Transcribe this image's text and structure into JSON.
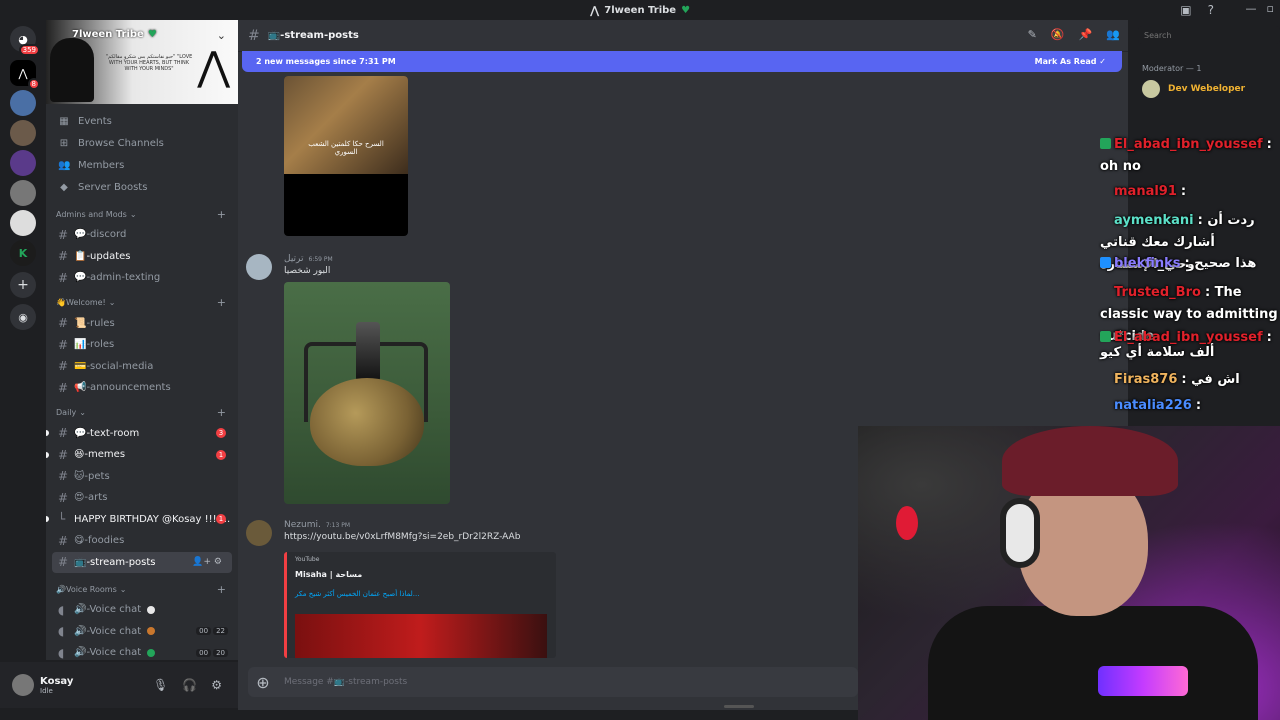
{
  "window": {
    "title": "7lween Tribe",
    "heart": "♥"
  },
  "servers": {
    "dm_badge": "359",
    "second_badge": "8"
  },
  "server": {
    "name": "7lween Tribe",
    "heart": "♥",
    "banner_quote": "\"حبو نفاستكم بس شكرو مقالكم\" \"LOVE WITH YOUR HEARTS, BUT THINK WITH YOUR MINDS\""
  },
  "nav": [
    {
      "icon": "calendar-icon",
      "glyph": "▦",
      "label": "Events"
    },
    {
      "icon": "browse-icon",
      "glyph": "⊞",
      "label": "Browse Channels"
    },
    {
      "icon": "members-icon",
      "glyph": "👥",
      "label": "Members"
    },
    {
      "icon": "boost-icon",
      "glyph": "◆",
      "label": "Server Boosts"
    }
  ],
  "categories": {
    "admins": "Admins and Mods",
    "welcome": "👋Welcome!",
    "daily": "Daily",
    "voice": "🔊Voice Rooms"
  },
  "channels_admins": [
    {
      "label": "💬-discord"
    },
    {
      "label": "📋-updates",
      "unread": true
    },
    {
      "label": "💬-admin-texting"
    }
  ],
  "channels_welcome": [
    {
      "label": "📜-rules"
    },
    {
      "label": "📊-roles"
    },
    {
      "label": "💳-social-media"
    },
    {
      "label": "📢-announcements"
    }
  ],
  "channels_daily": [
    {
      "label": "💬-text-room",
      "badge": "3"
    },
    {
      "label": "😆-memes",
      "badge": "1"
    },
    {
      "label": "🐱-pets"
    },
    {
      "label": "😍-arts"
    },
    {
      "label": "HAPPY BIRTHDAY @Kosay !!!!...",
      "badge": "1",
      "thread": true
    },
    {
      "label": "😋-foodies"
    },
    {
      "label": "📺-stream-posts",
      "active": true
    }
  ],
  "voice_channels": [
    {
      "label": "🔊-Voice chat",
      "dot": "#e8e8e8"
    },
    {
      "label": "🔊-Voice chat",
      "dot": "#c9772d",
      "counts": [
        "00",
        "22"
      ]
    },
    {
      "label": "🔊-Voice chat",
      "dot": "#23a55a",
      "counts": [
        "00",
        "20"
      ]
    }
  ],
  "user": {
    "name": "Kosay",
    "status": "Idle"
  },
  "channel": {
    "name": "📺-stream-posts"
  },
  "new_messages": {
    "text": "2 new messages since 7:31 PM",
    "mark_label": "Mark As Read"
  },
  "video_caption": "السرح حكا كلمتين الشعب السوري",
  "messages": [
    {
      "author": "ترتيل",
      "time": "6:59 PM",
      "text": "البور شخصيا"
    },
    {
      "author": "Nezumi.",
      "time": "7:13 PM",
      "link": "https://youtu.be/v0xLrfM8Mfg?si=2eb_rDr2l2RZ-AAb"
    }
  ],
  "embed": {
    "provider": "YouTube",
    "title": "Misaha | مساحة",
    "description": "لماذا أصبح عثمان الخميس أكثر شيخ مكر..."
  },
  "composer": {
    "placeholder": "Message #📺-stream-posts"
  },
  "search": {
    "placeholder": "Search"
  },
  "members": {
    "moderator_heading": "Moderator — 1",
    "mod_name": "Dev Webeloper"
  },
  "stream_chat": [
    {
      "user": "El_abad_ibn_youssef",
      "color": "#e0212b",
      "text": ": oh no"
    },
    {
      "user": "manal91",
      "color": "#e0212b",
      "text": ":"
    },
    {
      "user": "aymenkani",
      "color": "#5ce0c8",
      "text": ": ردت أن أشارك معك قناتي وحي_الإستنارة"
    },
    {
      "user": "blekfinks",
      "color": "#8a7cff",
      "text": ": هذا صحيح"
    },
    {
      "user": "Trusted_Bro",
      "color": "#e0212b",
      "text": ": The classic way to admitting su*cide"
    },
    {
      "user": "El_abad_ibn_youssef",
      "color": "#e0212b",
      "text": ": ألف سلامة أي كيو"
    },
    {
      "user": "Firas876",
      "color": "#f0b45e",
      "text": ": اش في"
    },
    {
      "user": "natalia226",
      "color": "#4a8cff",
      "text": ":"
    }
  ],
  "colors": {
    "accent": "#5865f2",
    "badge": "#f23f43",
    "link": "#00a8fc"
  }
}
